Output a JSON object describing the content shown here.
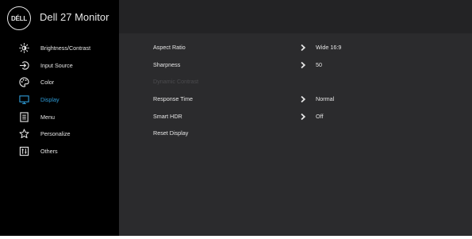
{
  "header": {
    "logo_text": "DÉLL",
    "title": "Dell 27 Monitor"
  },
  "sidebar": {
    "items": [
      {
        "label": "Brightness/Contrast",
        "icon": "brightness-icon",
        "active": false
      },
      {
        "label": "Input Source",
        "icon": "input-source-icon",
        "active": false
      },
      {
        "label": "Color",
        "icon": "color-palette-icon",
        "active": false
      },
      {
        "label": "Display",
        "icon": "monitor-icon",
        "active": true
      },
      {
        "label": "Menu",
        "icon": "menu-icon",
        "active": false
      },
      {
        "label": "Personalize",
        "icon": "star-icon",
        "active": false
      },
      {
        "label": "Others",
        "icon": "others-icon",
        "active": false
      }
    ]
  },
  "display_settings": {
    "rows": [
      {
        "label": "Aspect Ratio",
        "value": "Wide 16:9",
        "has_chevron": true,
        "enabled": true
      },
      {
        "label": "Sharpness",
        "value": "50",
        "has_chevron": true,
        "enabled": true
      },
      {
        "label": "Dynamic Contrast",
        "value": "",
        "has_chevron": false,
        "enabled": false
      },
      {
        "label": "Response Time",
        "value": "Normal",
        "has_chevron": true,
        "enabled": true
      },
      {
        "label": "Smart HDR",
        "value": "Off",
        "has_chevron": true,
        "enabled": true
      },
      {
        "label": "Reset Display",
        "value": "",
        "has_chevron": false,
        "enabled": true
      }
    ]
  },
  "colors": {
    "accent": "#2f9bd6",
    "text": "#e6e6e6",
    "disabled_text": "#4b4b4e",
    "sidebar_bg": "#000000",
    "content_bg": "#2b2b2d"
  }
}
